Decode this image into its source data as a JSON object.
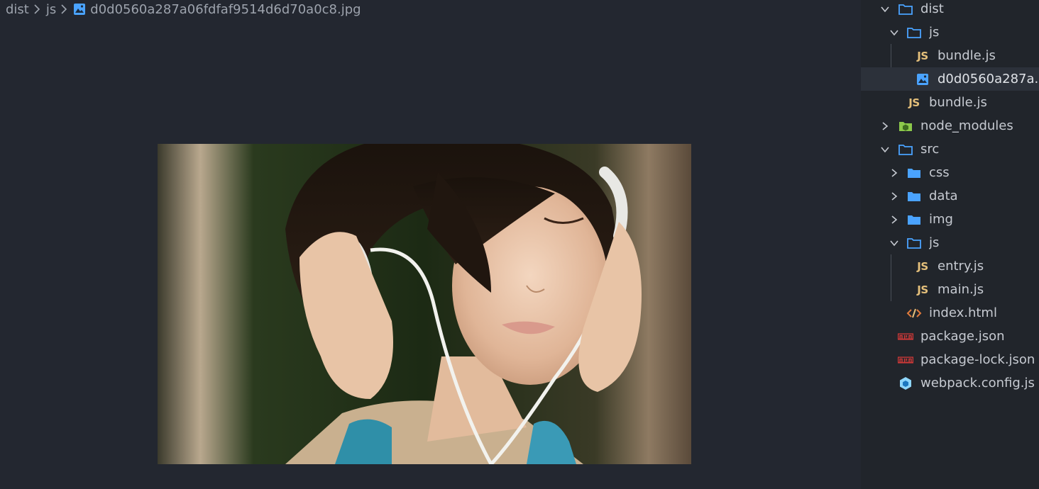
{
  "breadcrumb": {
    "items": [
      "dist",
      "js"
    ],
    "file": "d0d0560a287a06fdfaf9514d6d70a0c8.jpg"
  },
  "explorer": {
    "rows": [
      {
        "label": "dist",
        "type": "folder-open",
        "depth": 1,
        "expanded": true
      },
      {
        "label": "js",
        "type": "folder-open",
        "depth": 2,
        "expanded": true
      },
      {
        "label": "bundle.js",
        "type": "js",
        "depth": 3
      },
      {
        "label": "d0d0560a287a...",
        "type": "image",
        "depth": 3,
        "selected": true
      },
      {
        "label": "bundle.js",
        "type": "js",
        "depth": 2
      },
      {
        "label": "node_modules",
        "type": "node-folder",
        "depth": 1,
        "expanded": false
      },
      {
        "label": "src",
        "type": "folder-open",
        "depth": 1,
        "expanded": true
      },
      {
        "label": "css",
        "type": "folder",
        "depth": 2,
        "expanded": false
      },
      {
        "label": "data",
        "type": "folder",
        "depth": 2,
        "expanded": false
      },
      {
        "label": "img",
        "type": "folder",
        "depth": 2,
        "expanded": false
      },
      {
        "label": "js",
        "type": "folder-open",
        "depth": 2,
        "expanded": true
      },
      {
        "label": "entry.js",
        "type": "js",
        "depth": 3
      },
      {
        "label": "main.js",
        "type": "js",
        "depth": 3
      },
      {
        "label": "index.html",
        "type": "html",
        "depth": 2
      },
      {
        "label": "package.json",
        "type": "npm",
        "depth": 1
      },
      {
        "label": "package-lock.json",
        "type": "npm",
        "depth": 1
      },
      {
        "label": "webpack.config.js",
        "type": "webpack",
        "depth": 1
      }
    ]
  },
  "icons": {
    "js_badge": "JS",
    "npm_badge": "npm"
  },
  "colors": {
    "folder": "#4aa3ff",
    "js": "#e5c07b",
    "html": "#e07a3c",
    "npm": "#cb3837",
    "webpack": "#8ed6fb",
    "node": "#8cc84b",
    "image_icon": "#4aa3ff"
  }
}
